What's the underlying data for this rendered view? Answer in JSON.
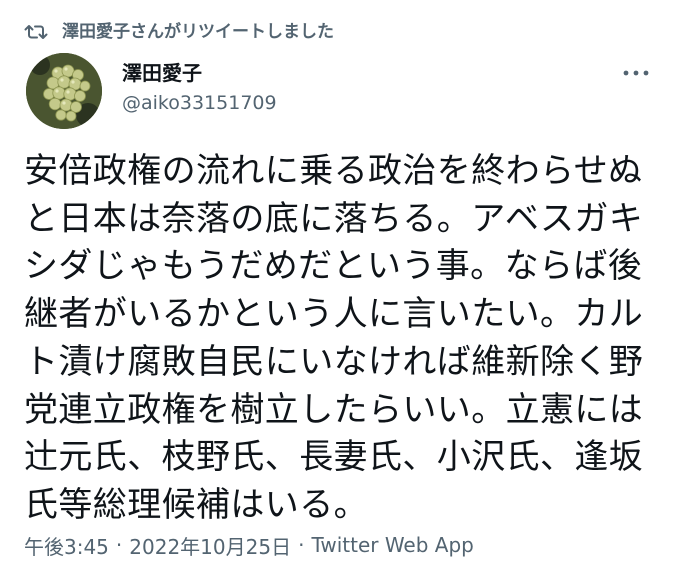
{
  "retweet": {
    "text": "澤田愛子さんがリツイートしました",
    "icon": "retweet-icon"
  },
  "author": {
    "name": "澤田愛子",
    "handle": "@aiko33151709",
    "avatar_icon": "avatar-grapes"
  },
  "more_icon": "more-horizontal-icon",
  "tweet": {
    "lines": [
      "安倍政権の流れに乗る政治を終わらせぬ",
      "と日本は奈落の底に落ちる。アベスガキ",
      "シダじゃもうだめだという事。ならば後",
      "継者がいるかという人に言いたい。カル",
      "ト漬け腐敗自民にいなければ維新除く野",
      "党連立政権を樹立したらいい。立憲には",
      "辻元氏、枝野氏、長妻氏、小沢氏、逢坂",
      "氏等総理候補はいる。"
    ]
  },
  "meta": {
    "time": "午後3:45",
    "separator": "·",
    "date": "2022年10月25日",
    "source": "Twitter Web App"
  },
  "colors": {
    "text": "#0f1419",
    "secondary": "#536471",
    "background": "#ffffff"
  }
}
